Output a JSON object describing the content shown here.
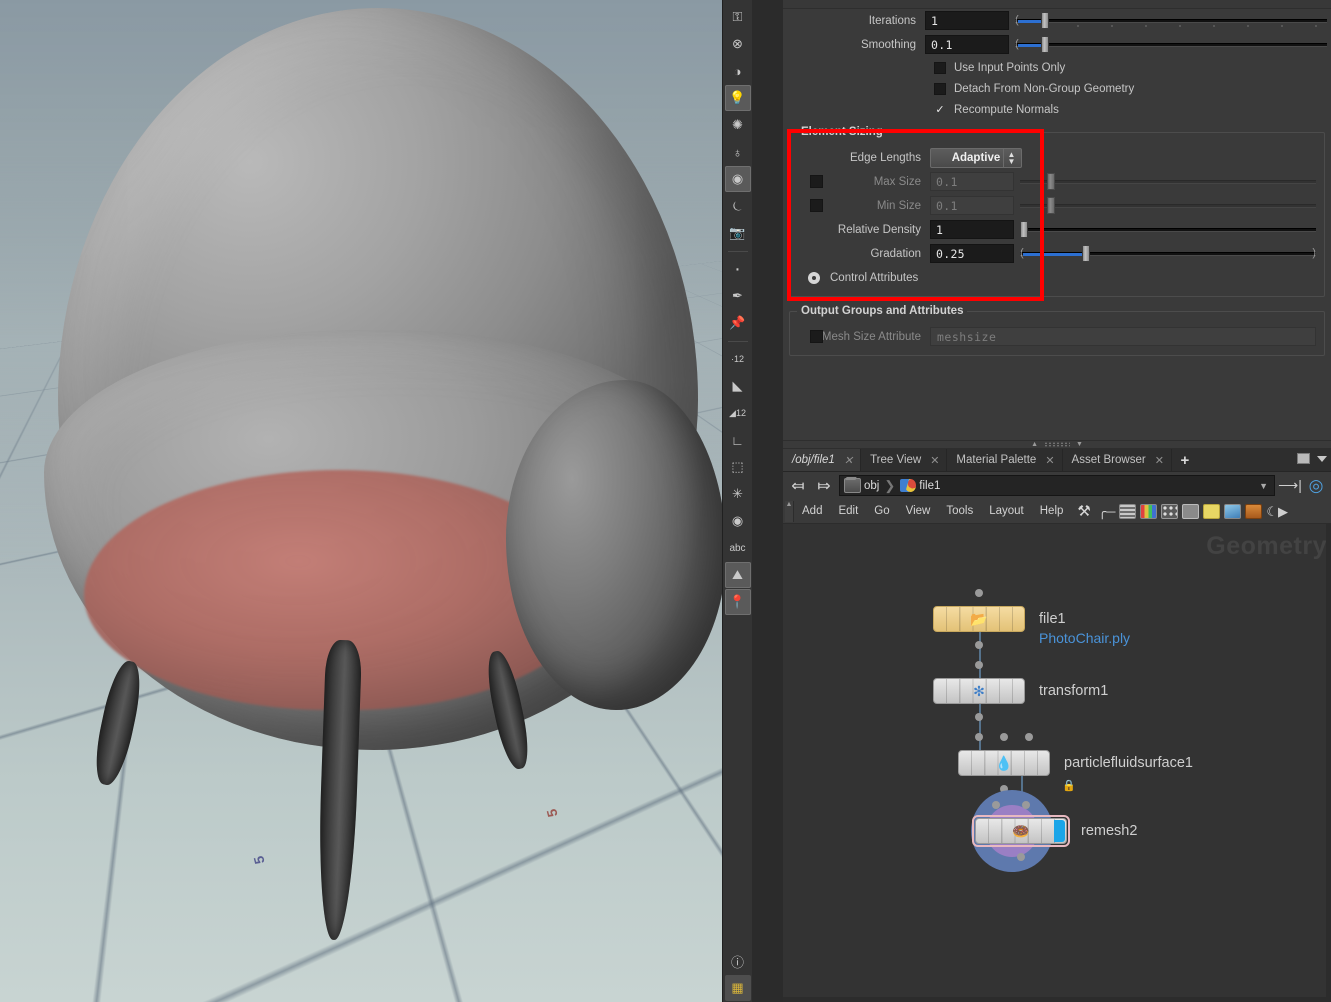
{
  "viewport": {
    "grid_labels": [
      {
        "text": "5",
        "axis": "z"
      },
      {
        "text": "5",
        "axis": "x"
      }
    ],
    "toolbar_top": [
      {
        "name": "lock-icon",
        "glyph": "⚿"
      },
      {
        "name": "no-light-icon",
        "glyph": "⊗"
      },
      {
        "name": "headlight-icon",
        "glyph": "◑"
      },
      {
        "name": "scene-lights-icon",
        "glyph": "Ὂ1"
      },
      {
        "name": "point-light-icon",
        "glyph": "✺"
      },
      {
        "name": "area-light-icon",
        "glyph": "♁"
      },
      {
        "name": "shaded-mode-icon",
        "glyph": "●"
      },
      {
        "name": "display-options-icon",
        "glyph": "⌾"
      },
      {
        "name": "camera-icon",
        "glyph": "὏7"
      },
      {
        "name": "point-display-icon",
        "glyph": "·"
      },
      {
        "name": "brush-icon",
        "glyph": "✒"
      },
      {
        "name": "pin-icon",
        "glyph": "Ὄc"
      }
    ],
    "toolbar_mid": [
      {
        "name": "point-numbers-icon",
        "glyph": "12"
      },
      {
        "name": "primitive-icon",
        "glyph": "◣"
      },
      {
        "name": "primitive-numbers-icon",
        "glyph": "12"
      },
      {
        "name": "angle-measure-icon",
        "glyph": "∟"
      },
      {
        "name": "bounding-box-icon",
        "glyph": "⬚"
      },
      {
        "name": "normals-icon",
        "glyph": "✳"
      },
      {
        "name": "text-panel-icon",
        "glyph": "☰"
      },
      {
        "name": "abc-icon",
        "glyph": "abc"
      },
      {
        "name": "image-plane-icon",
        "glyph": "⛰"
      },
      {
        "name": "bookmark-icon",
        "glyph": "Ὄd"
      }
    ],
    "toolbar_bottom": [
      {
        "name": "info-icon",
        "glyph": "ⓘ"
      },
      {
        "name": "grid-snap-icon",
        "glyph": "⊞"
      }
    ]
  },
  "parameters": {
    "top_rows": [
      {
        "label": "Iterations",
        "value": "1",
        "type": "slider",
        "fill": 26,
        "handle": 26,
        "ticks": true
      },
      {
        "label": "Smoothing",
        "value": "0.1",
        "type": "slider",
        "fill": 26,
        "handle": 26,
        "ticks": false
      }
    ],
    "toggles": [
      {
        "label": "Use Input Points Only",
        "checked": false
      },
      {
        "label": "Detach From Non-Group Geometry",
        "checked": false
      },
      {
        "label": "Recompute Normals",
        "checked": true
      }
    ],
    "element_sizing": {
      "title": "Element Sizing",
      "edge_lengths": {
        "label": "Edge Lengths",
        "value": "Adaptive"
      },
      "rows": [
        {
          "label": "Max Size",
          "value": "0.1",
          "disabled": true,
          "has_lock": true,
          "handle": 27
        },
        {
          "label": "Min Size",
          "value": "0.1",
          "disabled": true,
          "has_lock": true,
          "handle": 27
        },
        {
          "label": "Relative Density",
          "value": "1",
          "disabled": false,
          "handle": 1,
          "fill": 0
        },
        {
          "label": "Gradation",
          "value": "0.25",
          "disabled": false,
          "handle": 68,
          "fill": 68,
          "paren": true
        }
      ],
      "control_attributes": "Control Attributes"
    },
    "output_groups": {
      "title": "Output Groups and Attributes",
      "mesh_size_attribute": {
        "label": "Mesh Size Attribute",
        "value": "meshsize",
        "checked": false
      }
    },
    "highlight_color": "#ff0000",
    "accent_color": "#2c6fd1"
  },
  "network": {
    "tabs": [
      {
        "label": "/obj/file1",
        "active": true,
        "closable": true
      },
      {
        "label": "Tree View",
        "active": false,
        "closable": true
      },
      {
        "label": "Material Palette",
        "active": false,
        "closable": true
      },
      {
        "label": "Asset Browser",
        "active": false,
        "closable": true
      }
    ],
    "tab_add": "+",
    "path": {
      "back_icon": "←",
      "forward_icon": "→",
      "crumbs": [
        {
          "icon": "obj-icon",
          "label": "obj"
        },
        {
          "icon": "geometry-icon",
          "label": "file1"
        }
      ],
      "pin_icon": "⊸",
      "target_icon": "◎"
    },
    "menus": [
      "Add",
      "Edit",
      "Go",
      "View",
      "Tools",
      "Layout",
      "Help"
    ],
    "menu_icons": [
      {
        "name": "tools-wrench-icon"
      },
      {
        "name": "hierarchy-icon"
      },
      {
        "name": "list-view-icon"
      },
      {
        "name": "color-palette-icon"
      },
      {
        "name": "grid-layout-icon"
      },
      {
        "name": "dependency-icon"
      },
      {
        "name": "sticky-note-icon"
      },
      {
        "name": "add-image-icon"
      },
      {
        "name": "asset-box-icon"
      },
      {
        "name": "moon-phase-icon"
      }
    ],
    "watermark": "Geometry",
    "nodes": [
      {
        "name": "file1",
        "subtitle": "PhotoChair.ply",
        "icon": "Ὄ2",
        "kind": "file",
        "selected": false,
        "locked": false,
        "flag": false
      },
      {
        "name": "transform1",
        "subtitle": "",
        "icon": "✥",
        "kind": "sop",
        "selected": false,
        "locked": false,
        "flag": false
      },
      {
        "name": "particlefluidsurface1",
        "subtitle": "",
        "icon": "Ὂ7",
        "kind": "sop",
        "selected": false,
        "locked": true,
        "flag": false
      },
      {
        "name": "remesh2",
        "subtitle": "",
        "icon": "ἶ9",
        "kind": "sop",
        "selected": true,
        "locked": false,
        "flag": true
      }
    ]
  }
}
